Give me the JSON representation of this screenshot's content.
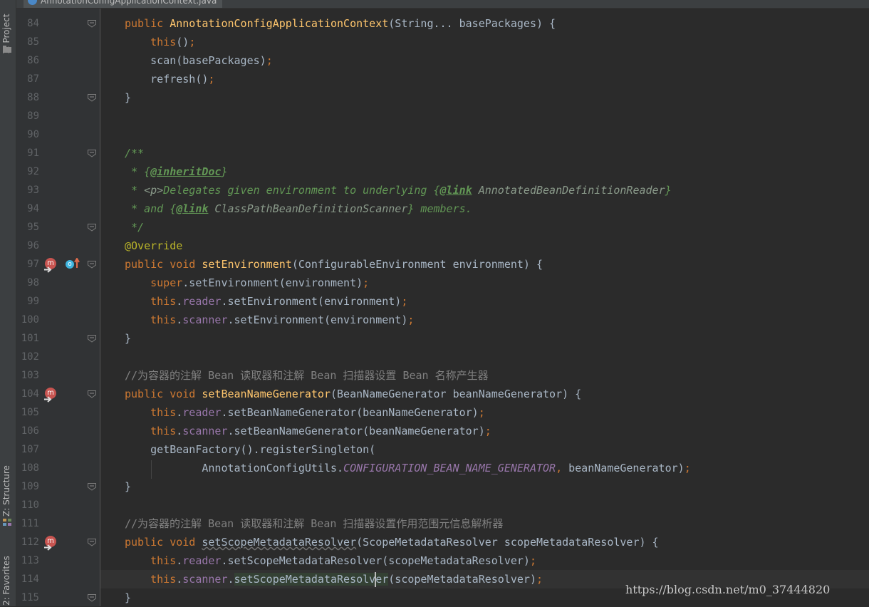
{
  "window": {
    "file_tab": "AnnotationConfigApplicationContext.java"
  },
  "tool_windows": {
    "project": "1: Project",
    "structure": "Z: Structure",
    "favorites": "2: Favorites"
  },
  "icons": {
    "file": "java-class-icon",
    "method_marker": "method-icon",
    "override_marker": "override-up-arrow-icon",
    "fold": "fold-marker-icon"
  },
  "colors": {
    "background": "#2b2b2b",
    "keyword": "#cc7832",
    "method": "#ffc66d",
    "field": "#9876aa",
    "comment": "#808080",
    "javadoc": "#629755",
    "annotation": "#bbb529",
    "text": "#a9b7c6"
  },
  "editor": {
    "caret_line": "114",
    "lines": [
      {
        "n": "84",
        "tokens": [
          {
            "c": "kw",
            "t": "public "
          },
          {
            "c": "fn",
            "t": "AnnotationConfigApplicationContext"
          },
          {
            "c": "",
            "t": "(String... basePackages) {"
          }
        ]
      },
      {
        "n": "85",
        "tokens": [
          {
            "c": "",
            "t": "    "
          },
          {
            "c": "kw",
            "t": "this"
          },
          {
            "c": "",
            "t": "()"
          },
          {
            "c": "semi",
            "t": ";"
          }
        ]
      },
      {
        "n": "86",
        "tokens": [
          {
            "c": "",
            "t": "    scan(basePackages)"
          },
          {
            "c": "semi",
            "t": ";"
          }
        ]
      },
      {
        "n": "87",
        "tokens": [
          {
            "c": "",
            "t": "    refresh()"
          },
          {
            "c": "semi",
            "t": ";"
          }
        ]
      },
      {
        "n": "88",
        "tokens": [
          {
            "c": "",
            "t": "}"
          }
        ]
      },
      {
        "n": "89",
        "tokens": []
      },
      {
        "n": "90",
        "tokens": []
      },
      {
        "n": "91",
        "tokens": [
          {
            "c": "doc",
            "t": "/**"
          }
        ]
      },
      {
        "n": "92",
        "tokens": [
          {
            "c": "doc",
            "t": " * {"
          },
          {
            "c": "tag",
            "t": "@inheritDoc"
          },
          {
            "c": "doc",
            "t": "}"
          }
        ]
      },
      {
        "n": "93",
        "tokens": [
          {
            "c": "doc",
            "t": " * "
          },
          {
            "c": "ref",
            "t": "<p>"
          },
          {
            "c": "doc",
            "t": "Delegates given environment to underlying {"
          },
          {
            "c": "tag",
            "t": "@link"
          },
          {
            "c": "ref",
            "t": " AnnotatedBeanDefinitionReader"
          },
          {
            "c": "doc",
            "t": "}"
          }
        ]
      },
      {
        "n": "94",
        "tokens": [
          {
            "c": "doc",
            "t": " * and {"
          },
          {
            "c": "tag",
            "t": "@link"
          },
          {
            "c": "ref",
            "t": " ClassPathBeanDefinitionScanner"
          },
          {
            "c": "doc",
            "t": "} members."
          }
        ]
      },
      {
        "n": "95",
        "tokens": [
          {
            "c": "doc",
            "t": " */"
          }
        ]
      },
      {
        "n": "96",
        "tokens": [
          {
            "c": "ann",
            "t": "@Override"
          }
        ]
      },
      {
        "n": "97",
        "tokens": [
          {
            "c": "kw",
            "t": "public void "
          },
          {
            "c": "fn",
            "t": "setEnvironment"
          },
          {
            "c": "",
            "t": "(ConfigurableEnvironment environment) {"
          }
        ]
      },
      {
        "n": "98",
        "tokens": [
          {
            "c": "",
            "t": "    "
          },
          {
            "c": "kw",
            "t": "super"
          },
          {
            "c": "",
            "t": ".setEnvironment(environment)"
          },
          {
            "c": "semi",
            "t": ";"
          }
        ]
      },
      {
        "n": "99",
        "tokens": [
          {
            "c": "",
            "t": "    "
          },
          {
            "c": "kw",
            "t": "this"
          },
          {
            "c": "",
            "t": "."
          },
          {
            "c": "fld",
            "t": "reader"
          },
          {
            "c": "",
            "t": ".setEnvironment(environment)"
          },
          {
            "c": "semi",
            "t": ";"
          }
        ]
      },
      {
        "n": "100",
        "tokens": [
          {
            "c": "",
            "t": "    "
          },
          {
            "c": "kw",
            "t": "this"
          },
          {
            "c": "",
            "t": "."
          },
          {
            "c": "fld",
            "t": "scanner"
          },
          {
            "c": "",
            "t": ".setEnvironment(environment)"
          },
          {
            "c": "semi",
            "t": ";"
          }
        ]
      },
      {
        "n": "101",
        "tokens": [
          {
            "c": "",
            "t": "}"
          }
        ]
      },
      {
        "n": "102",
        "tokens": []
      },
      {
        "n": "103",
        "tokens": [
          {
            "c": "cmt",
            "t": "//为容器的注解 Bean 读取器和注解 Bean 扫描器设置 Bean 名称产生器"
          }
        ]
      },
      {
        "n": "104",
        "tokens": [
          {
            "c": "kw",
            "t": "public void "
          },
          {
            "c": "fn",
            "t": "setBeanNameGenerator"
          },
          {
            "c": "",
            "t": "(BeanNameGenerator beanNameGenerator) {"
          }
        ]
      },
      {
        "n": "105",
        "tokens": [
          {
            "c": "",
            "t": "    "
          },
          {
            "c": "kw",
            "t": "this"
          },
          {
            "c": "",
            "t": "."
          },
          {
            "c": "fld",
            "t": "reader"
          },
          {
            "c": "",
            "t": ".setBeanNameGenerator(beanNameGenerator)"
          },
          {
            "c": "semi",
            "t": ";"
          }
        ]
      },
      {
        "n": "106",
        "tokens": [
          {
            "c": "",
            "t": "    "
          },
          {
            "c": "kw",
            "t": "this"
          },
          {
            "c": "",
            "t": "."
          },
          {
            "c": "fld",
            "t": "scanner"
          },
          {
            "c": "",
            "t": ".setBeanNameGenerator(beanNameGenerator)"
          },
          {
            "c": "semi",
            "t": ";"
          }
        ]
      },
      {
        "n": "107",
        "tokens": [
          {
            "c": "",
            "t": "    getBeanFactory().registerSingleton("
          }
        ]
      },
      {
        "n": "108",
        "tokens": [
          {
            "c": "",
            "t": "            AnnotationConfigUtils."
          },
          {
            "c": "sfld",
            "t": "CONFIGURATION_BEAN_NAME_GENERATOR"
          },
          {
            "c": "semi",
            "t": ", "
          },
          {
            "c": "",
            "t": "beanNameGenerator)"
          },
          {
            "c": "semi",
            "t": ";"
          }
        ]
      },
      {
        "n": "109",
        "tokens": [
          {
            "c": "",
            "t": "}"
          }
        ]
      },
      {
        "n": "110",
        "tokens": []
      },
      {
        "n": "111",
        "tokens": [
          {
            "c": "cmt",
            "t": "//为容器的注解 Bean 读取器和注解 Bean 扫描器设置作用范围元信息解析器"
          }
        ]
      },
      {
        "n": "112",
        "tokens": [
          {
            "c": "kw",
            "t": "public void "
          },
          {
            "c": "unused",
            "t": "setScopeMetadataResolver"
          },
          {
            "c": "",
            "t": "(ScopeMetadataResolver scopeMetadataResolver) {"
          }
        ]
      },
      {
        "n": "113",
        "tokens": [
          {
            "c": "",
            "t": "    "
          },
          {
            "c": "kw",
            "t": "this"
          },
          {
            "c": "",
            "t": "."
          },
          {
            "c": "fld",
            "t": "reader"
          },
          {
            "c": "",
            "t": ".setScopeMetadataResolver(scopeMetadataResolver)"
          },
          {
            "c": "semi",
            "t": ";"
          }
        ]
      },
      {
        "n": "114",
        "tokens": [
          {
            "c": "",
            "t": "    "
          },
          {
            "c": "kw",
            "t": "this"
          },
          {
            "c": "",
            "t": "."
          },
          {
            "c": "fld",
            "t": "scanner"
          },
          {
            "c": "",
            "t": "."
          },
          {
            "c": "hl",
            "t": "setScopeMetadataResolver"
          },
          {
            "c": "",
            "t": "(scopeMetadataResolver)"
          },
          {
            "c": "semi",
            "t": ";"
          }
        ]
      },
      {
        "n": "115",
        "tokens": [
          {
            "c": "",
            "t": "}"
          }
        ]
      }
    ]
  },
  "markers": {
    "fold_lines": [
      "84",
      "88",
      "91",
      "95",
      "97",
      "101",
      "104",
      "109",
      "112",
      "115"
    ],
    "method_icon_lines": [
      "97",
      "104",
      "112"
    ],
    "override_icon_lines": [
      "97"
    ]
  },
  "watermark": "https://blog.csdn.net/m0_37444820"
}
